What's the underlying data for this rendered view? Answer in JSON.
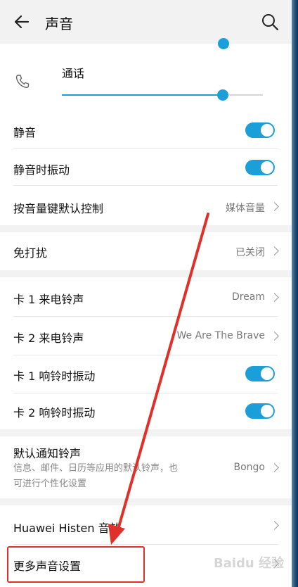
{
  "header": {
    "title": "声音"
  },
  "call": {
    "label": "通话",
    "volume_percent": 80
  },
  "rows": {
    "mute": {
      "label": "静音",
      "toggle": true
    },
    "mute_vibrate": {
      "label": "静音时振动",
      "toggle": true
    },
    "volume_key": {
      "label": "按音量键默认控制",
      "value": "媒体音量"
    },
    "dnd": {
      "label": "免打扰",
      "value": "已关闭"
    },
    "sim1_ringtone": {
      "label": "卡 1 来电铃声",
      "value": "Dream"
    },
    "sim2_ringtone": {
      "label": "卡 2 来电铃声",
      "value": "We Are The Brave"
    },
    "sim1_vibrate": {
      "label": "卡 1 响铃时振动",
      "toggle": true
    },
    "sim2_vibrate": {
      "label": "卡 2 响铃时振动",
      "toggle": true
    },
    "notification": {
      "label": "默认通知铃声",
      "sub_line1": "信息、邮件、日历等应用的默认铃声，也",
      "sub_line2": "可进行个性化设置",
      "value": "Bongo"
    },
    "histen": {
      "label": "Huawei Histen 音效"
    },
    "more": {
      "label": "更多声音设置"
    }
  },
  "watermark": "Baidu 经验",
  "colors": {
    "accent": "#1a9fd8",
    "annotation": "#e0302a"
  }
}
